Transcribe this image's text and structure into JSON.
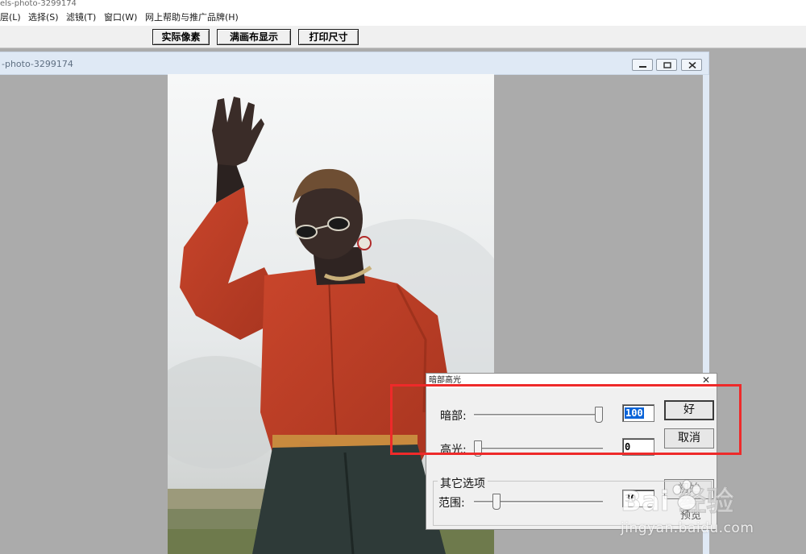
{
  "app": {
    "title": "els-photo-3299174"
  },
  "menu": [
    {
      "label": "层(L)"
    },
    {
      "label": "选择(S)"
    },
    {
      "label": "滤镜(T)"
    },
    {
      "label": "窗口(W)"
    },
    {
      "label": "网上帮助与推广品牌(H)"
    }
  ],
  "toolbar": {
    "buttons": [
      {
        "label": "实际像素"
      },
      {
        "label": "满画布显示"
      },
      {
        "label": "打印尺寸"
      }
    ]
  },
  "document": {
    "title": "-photo-3299174"
  },
  "dialog": {
    "title": "暗部高光",
    "shadow": {
      "label": "暗部:",
      "value": "100",
      "fraction": 1.0
    },
    "highlight": {
      "label": "高光:",
      "value": "0",
      "fraction": 0.0
    },
    "other_options": {
      "legend": "其它选项",
      "range": {
        "label": "范围:",
        "value": "30",
        "fraction": 0.15
      }
    },
    "ok_label": "好",
    "cancel_label": "取消",
    "reset_label": "初始",
    "preview_label": "预览"
  },
  "watermark": {
    "logo": "Bai 经验",
    "url": "jingyan.baidu.com"
  },
  "colors": {
    "highlight_box": "#ee2a2a",
    "selection": "#0a64d8",
    "workspace": "#ababab",
    "doc_titlebar": "#dfe9f5"
  },
  "icons": [
    "minimize-icon",
    "restore-icon",
    "close-icon",
    "paw-icon"
  ]
}
